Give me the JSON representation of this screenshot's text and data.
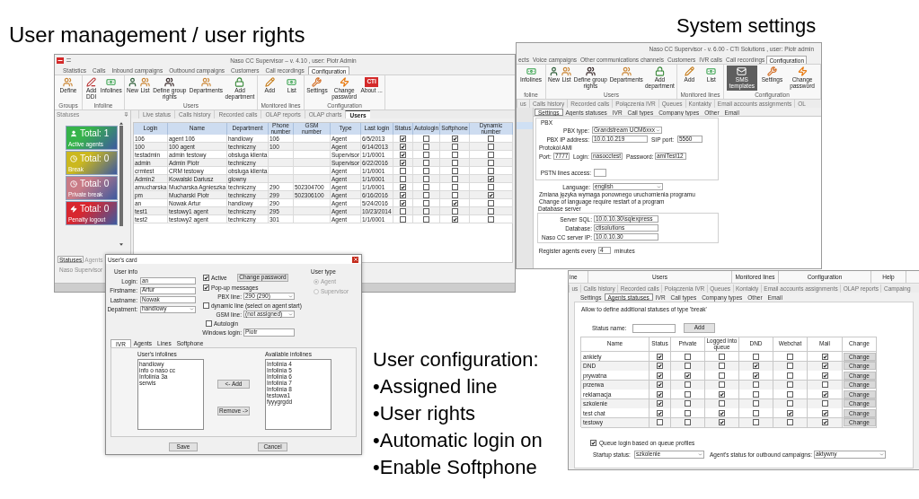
{
  "heading": "User management / user rights",
  "caption": "System settings",
  "main_window": {
    "title": "Naso CC Supervisor – v. 4.10 , user: Piotr Admin",
    "tabs": [
      {
        "label": "Statistics",
        "selected": false
      },
      {
        "label": "Calls",
        "selected": false
      },
      {
        "label": "Inbound campaigns",
        "selected": false
      },
      {
        "label": "Outbound campaigns",
        "selected": false
      },
      {
        "label": "Customers",
        "selected": false
      },
      {
        "label": "Call recordings",
        "selected": false
      },
      {
        "label": "Configuration",
        "selected": true
      }
    ],
    "ribbon": [
      {
        "label": "Groups",
        "buttons": [
          {
            "label": "Define"
          }
        ]
      },
      {
        "label": "Infoline",
        "buttons": [
          {
            "label": "Add DDI"
          },
          {
            "label": "Infolines"
          }
        ]
      },
      {
        "label": "Users",
        "buttons": [
          {
            "label": "New"
          },
          {
            "label": "List"
          },
          {
            "label": "Define group rights"
          },
          {
            "label": "Departments"
          },
          {
            "label": "Add department"
          }
        ]
      },
      {
        "label": "Monitored lines",
        "buttons": [
          {
            "label": "Add"
          },
          {
            "label": "List"
          }
        ]
      },
      {
        "label": "Configuration",
        "buttons": [
          {
            "label": "Settings"
          },
          {
            "label": "Change password"
          },
          {
            "label": "About ...",
            "logo_text": "CTI"
          }
        ]
      }
    ],
    "panel_title": "Statuses",
    "status_tiles": [
      {
        "total": "Total: 1",
        "label": "Active agents",
        "color": "#36b34a"
      },
      {
        "total": "Total: 0",
        "label": "Break",
        "color": "#cbb81e"
      },
      {
        "total": "Total: 0",
        "label": "Private break",
        "color": "#c97b86"
      },
      {
        "total": "Total: 0",
        "label": "Penalty logout",
        "color": "#d8262f"
      }
    ],
    "panel_tabs": [
      {
        "label": "Statuses",
        "selected": true
      },
      {
        "label": "Agents",
        "selected": false
      }
    ],
    "panel_footer": "Naso Supervisor",
    "view_tabs": [
      {
        "label": "Live status",
        "selected": false
      },
      {
        "label": "Calls history",
        "selected": false
      },
      {
        "label": "Recorded calls",
        "selected": false
      },
      {
        "label": "OLAP reports",
        "selected": false
      },
      {
        "label": "OLAP charts",
        "selected": false
      },
      {
        "label": "Users",
        "selected": true
      }
    ],
    "table": {
      "columns": [
        "Login",
        "Name",
        "Department",
        "Phone number",
        "GSM number",
        "Type",
        "Last login",
        "Status",
        "Autologin",
        "Softphone",
        "Dynamic number"
      ],
      "rows": [
        {
          "login": "106",
          "name": "agent 106",
          "department": "handlowy",
          "phone_number": "106",
          "type": "Agent",
          "last_login": "6/5/2013",
          "status": true,
          "autologin": false,
          "softphone": true,
          "dynamic_number": false
        },
        {
          "login": "100",
          "name": "100 agent",
          "department": "techniczny",
          "phone_number": "100",
          "type": "Agent",
          "last_login": "6/14/2013",
          "status": true,
          "autologin": false,
          "softphone": false,
          "dynamic_number": false
        },
        {
          "login": "testadmin",
          "name": "admin testowy",
          "department": "obsluga klienta",
          "type": "Supervisor",
          "last_login": "1/1/0001",
          "status": true,
          "autologin": false,
          "softphone": false,
          "dynamic_number": false
        },
        {
          "login": "admin",
          "name": "Admin Piotr",
          "department": "techniczny",
          "type": "Supervisor",
          "last_login": "6/22/2016",
          "status": true,
          "autologin": false,
          "softphone": false,
          "dynamic_number": false
        },
        {
          "login": "crmtest",
          "name": "CRM testowy",
          "department": "obsluga klienta",
          "type": "Agent",
          "last_login": "1/1/0001",
          "status": false,
          "autologin": false,
          "softphone": false,
          "dynamic_number": false
        },
        {
          "login": "Admin2",
          "name": "Kowalski Dariusz",
          "department": "glowny",
          "type": "Agent",
          "last_login": "1/1/0001",
          "status": false,
          "autologin": false,
          "softphone": false,
          "dynamic_number": true
        },
        {
          "login": "amucharska",
          "name": "Mucharska Agnieszka",
          "department": "techniczny",
          "phone_number": "290",
          "gsm_number": "502304700",
          "type": "Agent",
          "last_login": "1/1/0001",
          "status": true,
          "autologin": false,
          "softphone": false,
          "dynamic_number": false
        },
        {
          "login": "pm",
          "name": "Mucharski Piotr",
          "department": "techniczny",
          "phone_number": "299",
          "gsm_number": "502306100",
          "type": "Agent",
          "last_login": "6/16/2016",
          "status": true,
          "autologin": false,
          "softphone": false,
          "dynamic_number": true
        },
        {
          "login": "an",
          "name": "Nowak Artur",
          "department": "handlowy",
          "phone_number": "290",
          "type": "Agent",
          "last_login": "5/24/2016",
          "status": true,
          "autologin": false,
          "softphone": true,
          "dynamic_number": false
        },
        {
          "login": "test1",
          "name": "testowy1 agent",
          "department": "techniczny",
          "phone_number": "295",
          "type": "Agent",
          "last_login": "10/23/2014",
          "status": false,
          "autologin": false,
          "softphone": false,
          "dynamic_number": false
        },
        {
          "login": "test2",
          "name": "testowy2 agent",
          "department": "techniczny",
          "phone_number": "301",
          "type": "Agent",
          "last_login": "1/1/0001",
          "status": false,
          "autologin": false,
          "softphone": true,
          "dynamic_number": false
        }
      ]
    }
  },
  "settings_window": {
    "title": "Naso CC Supervisor - v. 6.00 - CTI Solutions , user: Piotr admin",
    "tabs": [
      {
        "label": "ects",
        "selected": false
      },
      {
        "label": "Voice campaigns",
        "selected": false
      },
      {
        "label": "Other communications channels",
        "selected": false
      },
      {
        "label": "Customers",
        "selected": false
      },
      {
        "label": "IVR calls",
        "selected": false
      },
      {
        "label": "Call recordings",
        "selected": false
      },
      {
        "label": "Configuration",
        "selected": true
      }
    ],
    "ribbon": [
      {
        "label": "foline",
        "buttons": [
          {
            "label": "Infolines",
            "selected": false
          }
        ]
      },
      {
        "label": "Users",
        "buttons": [
          {
            "label": "New",
            "selected": false
          },
          {
            "label": "List",
            "selected": false
          },
          {
            "label": "Define group rights",
            "selected": false
          },
          {
            "label": "Departments",
            "selected": false
          },
          {
            "label": "Add department",
            "selected": false
          }
        ]
      },
      {
        "label": "Monitored lines",
        "buttons": [
          {
            "label": "Add",
            "selected": false
          },
          {
            "label": "List",
            "selected": false
          }
        ]
      },
      {
        "label": "Configuration",
        "buttons": [
          {
            "label": "SMS templates",
            "selected": true
          },
          {
            "label": "Settings",
            "selected": false
          },
          {
            "label": "Change password",
            "selected": false
          }
        ]
      }
    ],
    "view_tabs": [
      "us",
      "Calls history",
      "Recorded calls",
      "Połączenia IVR",
      "Queues",
      "Kontakty",
      "Email accounts assignments",
      "OL"
    ],
    "sub_tabs": [
      {
        "label": "Settings",
        "selected": true
      },
      {
        "label": "Agents statuses",
        "selected": false
      },
      {
        "label": "IVR",
        "selected": false
      },
      {
        "label": "Call types",
        "selected": false
      },
      {
        "label": "Company types",
        "selected": false
      },
      {
        "label": "Other",
        "selected": false
      },
      {
        "label": "Email",
        "selected": false
      }
    ],
    "pbx": {
      "title": "PBX",
      "type": {
        "label": "PBX type:",
        "value": "Grandstream UCM6xxx"
      },
      "ip": {
        "label": "PBX IP address:",
        "value": "10.0.10.219"
      },
      "sip_port": {
        "label": "SIP port:",
        "value": "5560"
      },
      "ami": {
        "title": "Protokół AMI",
        "port": {
          "label": "Port:",
          "value": "7777"
        },
        "login": {
          "label": "Login:",
          "value": "nasocctest"
        },
        "password": {
          "label": "Password:",
          "value": "amiTest12"
        }
      },
      "pstn": {
        "label": "PSTN lines access:"
      }
    },
    "language": {
      "label": "Language:",
      "value": "english"
    },
    "language_notes": [
      "Zmiana języka wymaga ponownego uruchomienia programu",
      "Change of language require restart of a program"
    ],
    "database": {
      "title": "Database server",
      "fields": [
        {
          "label": "Server SQL:",
          "value": "10.0.10.30\\sqlexpress"
        },
        {
          "label": "Database:",
          "value": "ctisolutions"
        },
        {
          "label": "Naso CC server IP:",
          "value": "10.0.10.30"
        }
      ]
    },
    "register": {
      "label": "Register agents every",
      "value": "4",
      "unit": "minutes"
    }
  },
  "user_card": {
    "title": "User's card",
    "user_info": {
      "title": "User info",
      "fields": [
        {
          "label": "Login:",
          "value": "an",
          "kind": "text"
        },
        {
          "label": "Firstname:",
          "value": "Artur",
          "kind": "text"
        },
        {
          "label": "Lastname:",
          "value": "Nowak",
          "kind": "text"
        },
        {
          "label": "Depatment:",
          "value": "handlowy",
          "kind": "dropdown"
        }
      ]
    },
    "active": {
      "label": "Active",
      "checked": true
    },
    "change_password": "Change password",
    "popup_messages": {
      "label": "Pop-up messages",
      "checked": true
    },
    "pbx_line": {
      "label": "PBX line:",
      "value": "290 (290)"
    },
    "dynamic_line": {
      "label": "dynamic line (select on agent start)",
      "checked": false
    },
    "gsm_line": {
      "label": "GSM line:",
      "value": "(not assigned)"
    },
    "autologin": {
      "label": "Autologin",
      "checked": false
    },
    "windows_login": {
      "label": "Windows login:",
      "value": "Piotr"
    },
    "user_type": {
      "title": "User type",
      "disabled": true,
      "options": [
        {
          "label": "Agent",
          "selected": true
        },
        {
          "label": "Supervisor",
          "selected": false
        }
      ]
    },
    "tabs": [
      {
        "label": "IVR",
        "selected": true
      },
      {
        "label": "Agents",
        "selected": false
      },
      {
        "label": "Lines",
        "selected": false
      },
      {
        "label": "Softphone",
        "selected": false
      }
    ],
    "users_infolines": {
      "title": "User's infolines",
      "items": [
        "handlowy",
        "info o naso cc",
        "Infolinia 3a",
        "serwis"
      ]
    },
    "available_infolines": {
      "title": "Available infolines",
      "items": [
        "Infolinia 4",
        "Infolinia 5",
        "Infolinia 6",
        "Infolinia 7",
        "Infolinia 8",
        "testowa1",
        "fyyygrgdd"
      ]
    },
    "add_button": "<- Add",
    "remove_button": "Remove ->",
    "save_button": "Save",
    "cancel_button": "Cancel"
  },
  "notes": {
    "title": "User configuration:",
    "items": [
      "•Assigned line",
      "•User rights",
      "•Automatic login on",
      "•Enable Softphone"
    ]
  },
  "statuses_window": {
    "group_labels": [
      "ine",
      "Users",
      "Monitored lines",
      "Configuration",
      "Help"
    ],
    "view_tabs": [
      "us",
      "Calls history",
      "Recorded calls",
      "Połączenia IVR",
      "Queues",
      "Kontakty",
      "Email accounts assignments",
      "OLAP reports",
      "Campaing"
    ],
    "sub_tabs": [
      {
        "label": "Settings",
        "selected": false
      },
      {
        "label": "Agents statuses",
        "selected": true
      },
      {
        "label": "IVR",
        "selected": false
      },
      {
        "label": "Call types",
        "selected": false
      },
      {
        "label": "Company types",
        "selected": false
      },
      {
        "label": "Other",
        "selected": false
      },
      {
        "label": "Email",
        "selected": false
      }
    ],
    "description": "Allow to define additional statuses of type 'break'",
    "status_name_label": "Status name:",
    "add_button": "Add",
    "table": {
      "columns": [
        "Name",
        "Status",
        "Private",
        "Logged into queue",
        "DND",
        "Webchat",
        "Mail",
        "Change"
      ],
      "rows": [
        {
          "name": "ankiety",
          "status": true,
          "private": false,
          "logged_into_queue": false,
          "dnd": false,
          "webchat": false,
          "mail": true,
          "action": "Change"
        },
        {
          "name": "DND",
          "status": true,
          "private": false,
          "logged_into_queue": false,
          "dnd": true,
          "webchat": false,
          "mail": true,
          "action": "Change"
        },
        {
          "name": "prywatna",
          "status": true,
          "private": true,
          "logged_into_queue": false,
          "dnd": true,
          "webchat": false,
          "mail": true,
          "action": "Change"
        },
        {
          "name": "przerwa",
          "status": true,
          "private": false,
          "logged_into_queue": false,
          "dnd": false,
          "webchat": false,
          "mail": false,
          "action": "Change"
        },
        {
          "name": "reklamacja",
          "status": true,
          "private": false,
          "logged_into_queue": true,
          "dnd": false,
          "webchat": false,
          "mail": true,
          "action": "Change"
        },
        {
          "name": "szkolenie",
          "status": true,
          "private": false,
          "logged_into_queue": false,
          "dnd": false,
          "webchat": false,
          "mail": false,
          "action": "Change"
        },
        {
          "name": "test chat",
          "status": true,
          "private": false,
          "logged_into_queue": true,
          "dnd": false,
          "webchat": true,
          "mail": true,
          "action": "Change"
        },
        {
          "name": "testowy",
          "status": false,
          "private": false,
          "logged_into_queue": true,
          "dnd": false,
          "webchat": false,
          "mail": true,
          "action": "Change"
        }
      ]
    },
    "queue_login": {
      "label": "Queue login based on queue profiles",
      "checked": true
    },
    "startup_status": {
      "label": "Startup status:",
      "value": "szkolenie"
    },
    "outbound_status": {
      "label": "Agent's status for outbound campaigns:",
      "value": "aktywny"
    }
  }
}
